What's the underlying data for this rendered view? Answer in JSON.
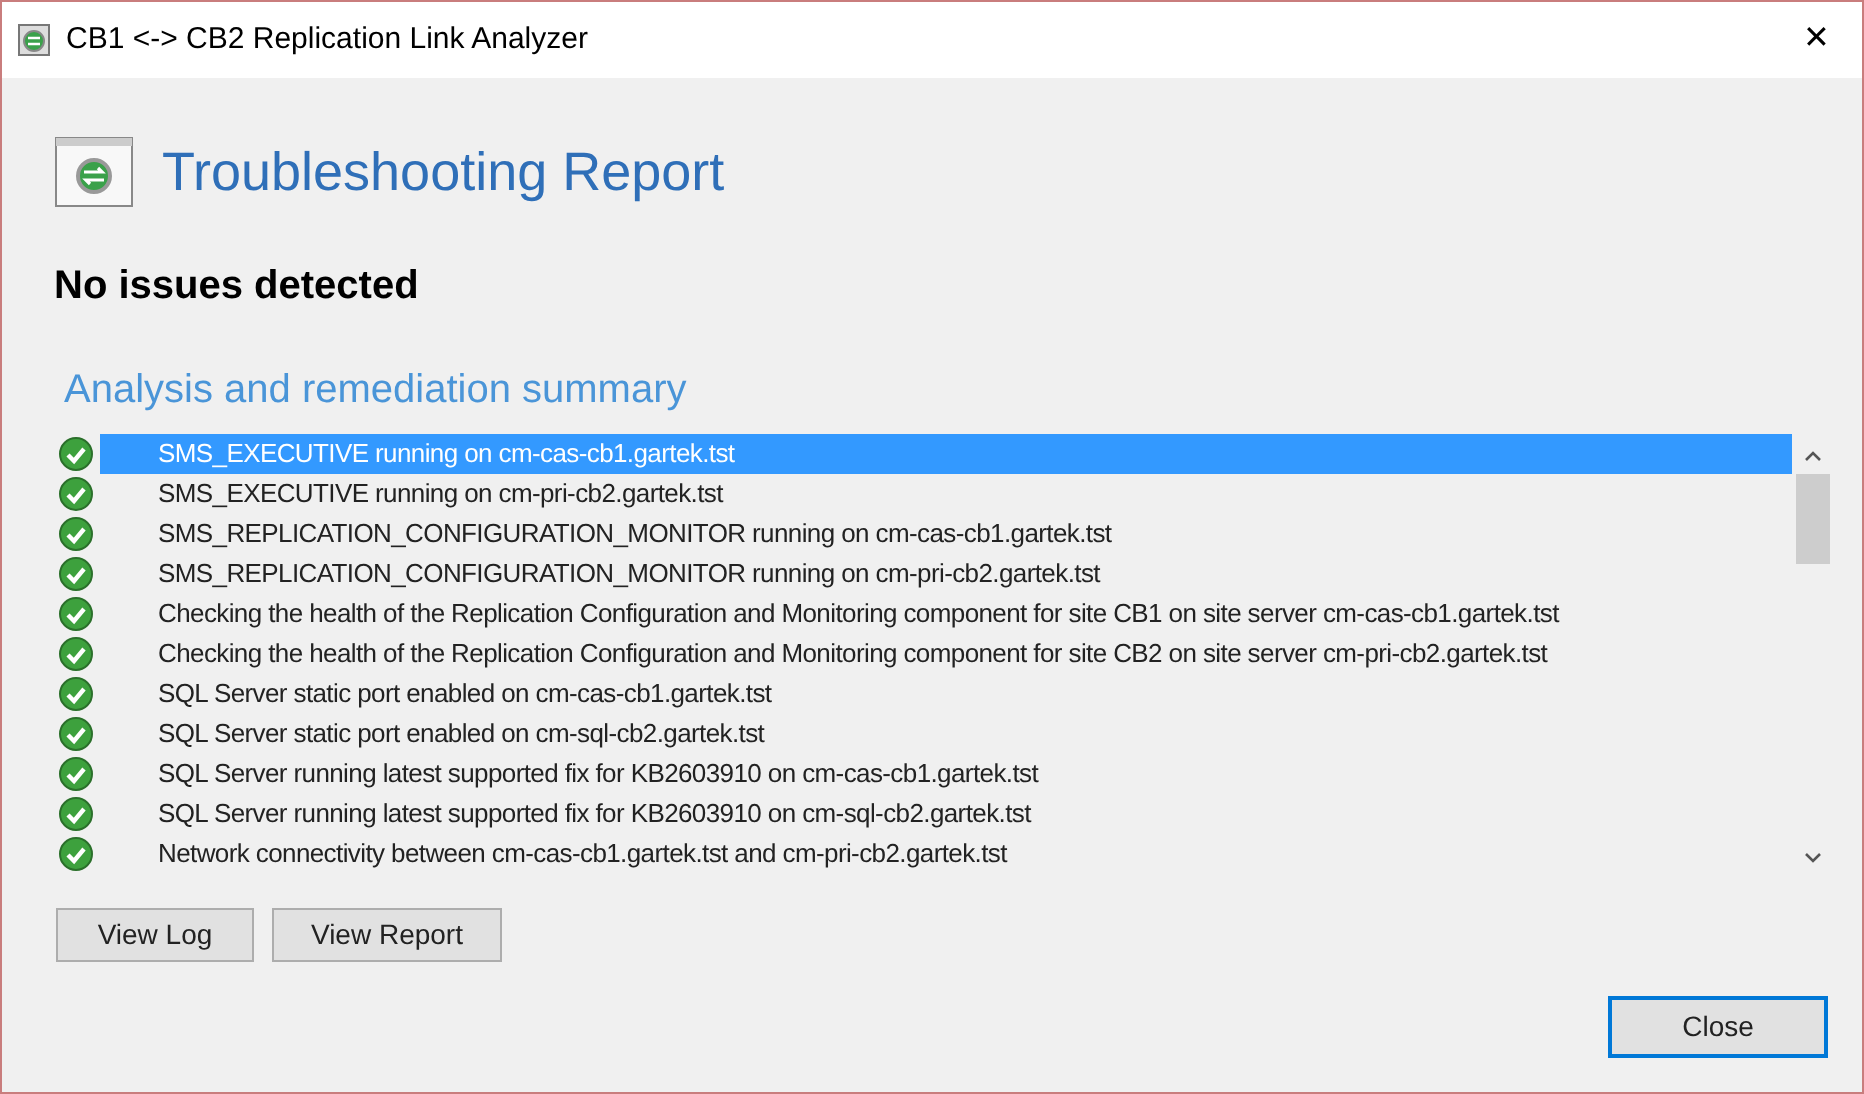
{
  "window": {
    "title": "CB1 <-> CB2 Replication Link Analyzer",
    "close_glyph": "✕"
  },
  "heading": "Troubleshooting Report",
  "result": "No issues detected",
  "summary": {
    "title": "Analysis and remediation summary",
    "items": [
      {
        "text": "SMS_EXECUTIVE running on cm-cas-cb1.gartek.tst",
        "kind": "ok",
        "selected": true
      },
      {
        "text": "SMS_EXECUTIVE running on cm-pri-cb2.gartek.tst",
        "kind": "ok",
        "selected": false
      },
      {
        "text": "SMS_REPLICATION_CONFIGURATION_MONITOR running on cm-cas-cb1.gartek.tst",
        "kind": "ok",
        "selected": false
      },
      {
        "text": "SMS_REPLICATION_CONFIGURATION_MONITOR running on cm-pri-cb2.gartek.tst",
        "kind": "ok",
        "selected": false
      },
      {
        "text": "Checking the health of the Replication Configuration and Monitoring component for site CB1 on site server cm-cas-cb1.gartek.tst",
        "kind": "ok",
        "selected": false
      },
      {
        "text": "Checking the health of the Replication Configuration and Monitoring component for site CB2 on site server cm-pri-cb2.gartek.tst",
        "kind": "ok",
        "selected": false
      },
      {
        "text": "SQL Server static port enabled on cm-cas-cb1.gartek.tst",
        "kind": "ok",
        "selected": false
      },
      {
        "text": "SQL Server static port enabled on cm-sql-cb2.gartek.tst",
        "kind": "ok",
        "selected": false
      },
      {
        "text": "SQL Server running latest supported fix for KB2603910 on cm-cas-cb1.gartek.tst",
        "kind": "ok",
        "selected": false
      },
      {
        "text": "SQL Server running latest supported fix for KB2603910 on cm-sql-cb2.gartek.tst",
        "kind": "ok",
        "selected": false
      },
      {
        "text": "Network connectivity between cm-cas-cb1.gartek.tst and cm-pri-cb2.gartek.tst",
        "kind": "ok",
        "selected": false
      }
    ]
  },
  "buttons": [
    {
      "label": "View Log",
      "default": false
    },
    {
      "label": "View Report",
      "default": false
    }
  ],
  "close_button": {
    "label": "Close",
    "default": true
  }
}
